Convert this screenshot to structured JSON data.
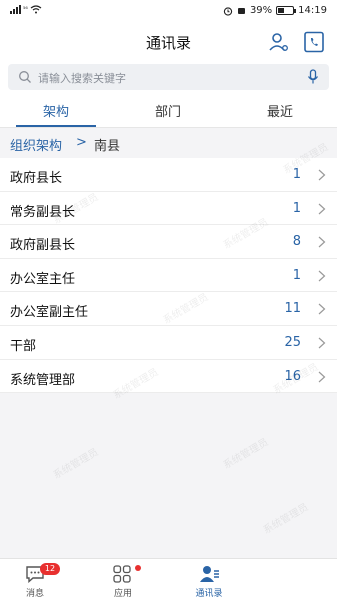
{
  "status_bar": {
    "left_text": "⁵⁶",
    "battery_percent": "39%",
    "battery_level": 0.39,
    "time": "14:19"
  },
  "header": {
    "title": "通讯录"
  },
  "search": {
    "placeholder": "请输入搜索关键字"
  },
  "tabs": [
    {
      "label": "架构",
      "active": true
    },
    {
      "label": "部门",
      "active": false
    },
    {
      "label": "最近",
      "active": false
    }
  ],
  "breadcrumb": {
    "root": "组织架构",
    "separator": ">",
    "current": "南县"
  },
  "list": [
    {
      "name": "政府县长",
      "count": "1"
    },
    {
      "name": "常务副县长",
      "count": "1"
    },
    {
      "name": "政府副县长",
      "count": "8"
    },
    {
      "name": "办公室主任",
      "count": "1"
    },
    {
      "name": "办公室副主任",
      "count": "11"
    },
    {
      "name": "干部",
      "count": "25"
    },
    {
      "name": "系统管理部",
      "count": "16"
    }
  ],
  "watermark_text": "系统管理员",
  "bottom_nav": [
    {
      "label": "消息",
      "badge": "12",
      "icon": "chat-icon"
    },
    {
      "label": "应用",
      "icon": "grid-icon"
    },
    {
      "label": "通讯录",
      "icon": "contacts-icon",
      "active": true
    }
  ],
  "colors": {
    "accent": "#2a64a6",
    "badge": "#e8302f"
  }
}
